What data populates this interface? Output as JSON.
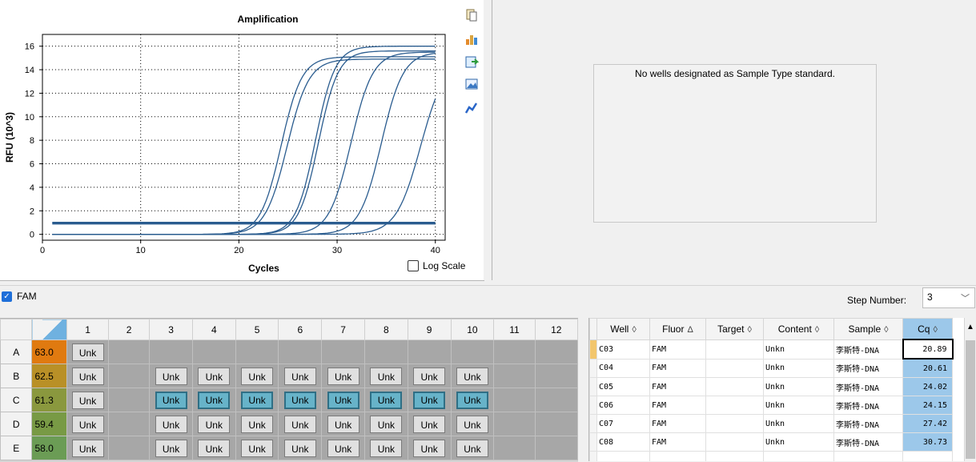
{
  "chart": {
    "title": "Amplification",
    "xlabel": "Cycles",
    "ylabel": "RFU (10^3)",
    "log_scale_label": "Log Scale"
  },
  "chart_data": {
    "type": "line",
    "title": "Amplification",
    "xlabel": "Cycles",
    "ylabel": "RFU (10^3)",
    "xlim": [
      0,
      41
    ],
    "ylim": [
      -0.5,
      17
    ],
    "xticks": [
      0,
      10,
      20,
      30,
      40
    ],
    "yticks": [
      0,
      2,
      4,
      6,
      8,
      10,
      12,
      14,
      16
    ],
    "grid": true,
    "series": [
      {
        "midpoint": 24.3,
        "slope": 0.95,
        "plateau": 15.1
      },
      {
        "midpoint": 24.9,
        "slope": 0.9,
        "plateau": 14.9
      },
      {
        "midpoint": 27.8,
        "slope": 1.0,
        "plateau": 16.0
      },
      {
        "midpoint": 28.1,
        "slope": 1.0,
        "plateau": 15.6
      },
      {
        "midpoint": 31.4,
        "slope": 0.9,
        "plateau": 15.5
      },
      {
        "midpoint": 34.5,
        "slope": 0.9,
        "plateau": 15.5
      },
      {
        "midpoint": 38.5,
        "slope": 0.8,
        "plateau": 15.0
      },
      {
        "flat": 1.0
      },
      {
        "flat": 0.9
      }
    ]
  },
  "standard_curve": {
    "message": "No wells designated as Sample Type standard."
  },
  "fluor_bar": {
    "fam_label": "FAM",
    "step_label": "Step Number:",
    "step_value": "3"
  },
  "plate": {
    "columns": [
      "1",
      "2",
      "3",
      "4",
      "5",
      "6",
      "7",
      "8",
      "9",
      "10",
      "11",
      "12"
    ],
    "rows": [
      {
        "label": "A",
        "temp": "63.0",
        "temp_color": "#e07a10",
        "wells": [
          "Unk",
          "",
          "",
          "",
          "",
          "",
          "",
          "",
          "",
          "",
          "",
          ""
        ],
        "selected": []
      },
      {
        "label": "B",
        "temp": "62.5",
        "temp_color": "#b99027",
        "wells": [
          "Unk",
          "",
          "Unk",
          "Unk",
          "Unk",
          "Unk",
          "Unk",
          "Unk",
          "Unk",
          "Unk",
          "",
          ""
        ],
        "selected": []
      },
      {
        "label": "C",
        "temp": "61.3",
        "temp_color": "#8a983e",
        "wells": [
          "Unk",
          "",
          "Unk",
          "Unk",
          "Unk",
          "Unk",
          "Unk",
          "Unk",
          "Unk",
          "Unk",
          "",
          ""
        ],
        "selected": [
          2,
          3,
          4,
          5,
          6,
          7,
          8,
          9
        ]
      },
      {
        "label": "D",
        "temp": "59.4",
        "temp_color": "#789a45",
        "wells": [
          "Unk",
          "",
          "Unk",
          "Unk",
          "Unk",
          "Unk",
          "Unk",
          "Unk",
          "Unk",
          "Unk",
          "",
          ""
        ],
        "selected": []
      },
      {
        "label": "E",
        "temp": "58.0",
        "temp_color": "#6b9c55",
        "wells": [
          "Unk",
          "",
          "Unk",
          "Unk",
          "Unk",
          "Unk",
          "Unk",
          "Unk",
          "Unk",
          "Unk",
          "",
          ""
        ],
        "selected": []
      }
    ]
  },
  "results": {
    "columns": [
      "Well",
      "Fluor",
      "Target",
      "Content",
      "Sample",
      "Cq"
    ],
    "sort_glyphs": [
      "◊",
      "Δ",
      "◊",
      "◊",
      "◊",
      "◊"
    ],
    "rows": [
      {
        "well": "C03",
        "fluor": "FAM",
        "target": "",
        "content": "Unkn",
        "sample": "李斯特-DNA",
        "cq": "20.89"
      },
      {
        "well": "C04",
        "fluor": "FAM",
        "target": "",
        "content": "Unkn",
        "sample": "李斯特-DNA",
        "cq": "20.61"
      },
      {
        "well": "C05",
        "fluor": "FAM",
        "target": "",
        "content": "Unkn",
        "sample": "李斯特-DNA",
        "cq": "24.02"
      },
      {
        "well": "C06",
        "fluor": "FAM",
        "target": "",
        "content": "Unkn",
        "sample": "李斯特-DNA",
        "cq": "24.15"
      },
      {
        "well": "C07",
        "fluor": "FAM",
        "target": "",
        "content": "Unkn",
        "sample": "李斯特-DNA",
        "cq": "27.42"
      },
      {
        "well": "C08",
        "fluor": "FAM",
        "target": "",
        "content": "Unkn",
        "sample": "李斯特-DNA",
        "cq": "30.73"
      },
      {
        "well": "",
        "fluor": "",
        "target": "",
        "content": "",
        "sample": "",
        "cq": ""
      }
    ]
  },
  "colors": {
    "curve": "#2a5c8f",
    "selected_well": "#67b3c9",
    "cq_cell": "#9cc8ea"
  },
  "icons": [
    "copy-icon",
    "export-chart-icon",
    "export-data-icon",
    "image-icon",
    "graph-style-icon"
  ]
}
